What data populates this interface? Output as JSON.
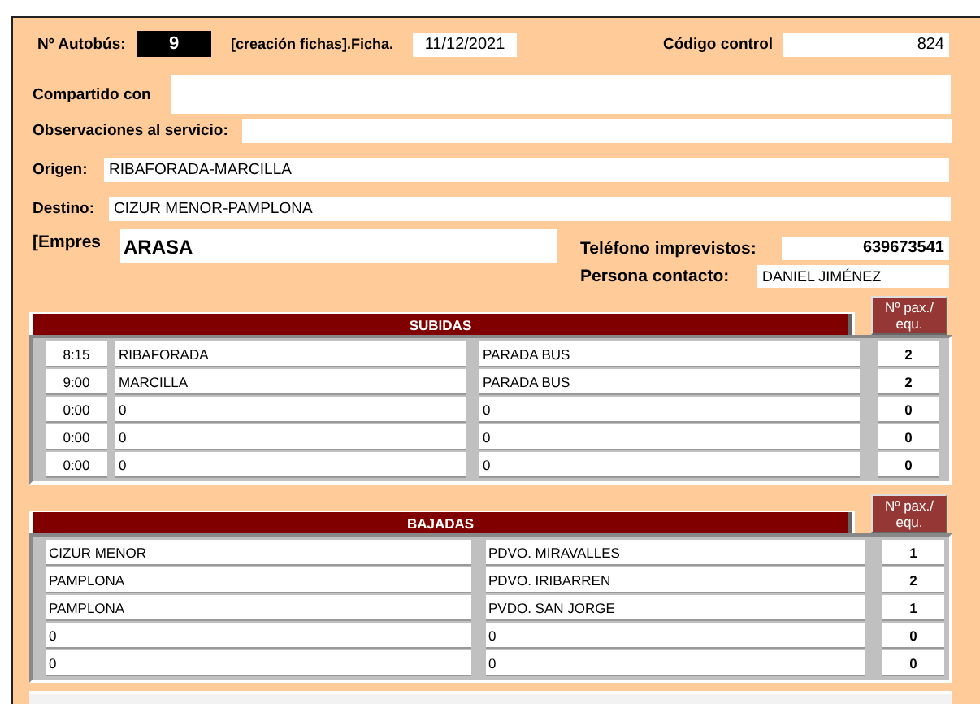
{
  "header": {
    "bus_label": "Nº Autobús:",
    "bus_number": "9",
    "sheet_label": "[creación fichas].Ficha.",
    "date": "11/12/2021",
    "control_label": "Código control",
    "control_code": "824"
  },
  "shared_with": {
    "label": "Compartido con"
  },
  "observations": {
    "label": "Observaciones al servicio:"
  },
  "origin": {
    "label": "Origen:",
    "value": "RIBAFORADA-MARCILLA"
  },
  "destination": {
    "label": "Destino:",
    "value": "CIZUR MENOR-PAMPLONA"
  },
  "company": {
    "label": "[Empres",
    "value": "ARASA"
  },
  "phone": {
    "label": "Teléfono imprevistos:",
    "value": "639673541"
  },
  "contact": {
    "label": "Persona contacto:",
    "value": "DANIEL JIMÉNEZ"
  },
  "subidas": {
    "title": "SUBIDAS",
    "pax_header": "Nº pax./ equ.",
    "rows": [
      {
        "time": "8:15",
        "place": "RIBAFORADA",
        "stop": "PARADA BUS",
        "pax": "2"
      },
      {
        "time": "9:00",
        "place": "MARCILLA",
        "stop": "PARADA BUS",
        "pax": "2"
      },
      {
        "time": "0:00",
        "place": "0",
        "stop": "0",
        "pax": "0"
      },
      {
        "time": "0:00",
        "place": "0",
        "stop": "0",
        "pax": "0"
      },
      {
        "time": "0:00",
        "place": "0",
        "stop": "0",
        "pax": "0"
      }
    ]
  },
  "bajadas": {
    "title": "BAJADAS",
    "pax_header": "Nº pax./ equ.",
    "rows": [
      {
        "place": "CIZUR MENOR",
        "stop": "PDVO. MIRAVALLES",
        "pax": "1"
      },
      {
        "place": "PAMPLONA",
        "stop": "PDVO. IRIBARREN",
        "pax": "2"
      },
      {
        "place": "PAMPLONA",
        "stop": "PVDO. SAN JORGE",
        "pax": "1"
      },
      {
        "place": "0",
        "stop": "0",
        "pax": "0"
      },
      {
        "place": "0",
        "stop": "0",
        "pax": "0"
      }
    ]
  }
}
